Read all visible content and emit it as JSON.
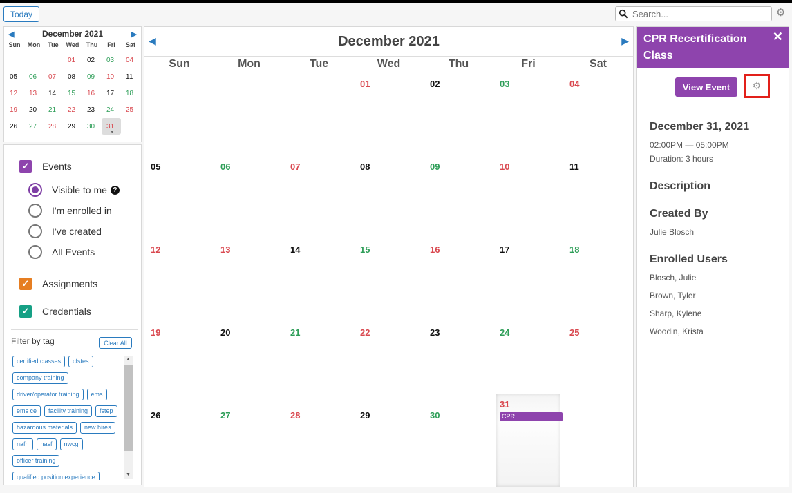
{
  "toolbar": {
    "today_label": "Today",
    "search_placeholder": "Search..."
  },
  "mini_calendar": {
    "title": "December 2021",
    "dow": [
      "Sun",
      "Mon",
      "Tue",
      "Wed",
      "Thu",
      "Fri",
      "Sat"
    ],
    "weeks": [
      [
        "",
        "",
        "",
        "01",
        "02",
        "03",
        "04"
      ],
      [
        "05",
        "06",
        "07",
        "08",
        "09",
        "10",
        "11"
      ],
      [
        "12",
        "13",
        "14",
        "15",
        "16",
        "17",
        "18"
      ],
      [
        "19",
        "20",
        "21",
        "22",
        "23",
        "24",
        "25"
      ],
      [
        "26",
        "27",
        "28",
        "29",
        "30",
        "31",
        ""
      ]
    ],
    "selected": "31"
  },
  "filters": {
    "events_label": "Events",
    "radios": [
      "Visible to me",
      "I'm enrolled in",
      "I've created",
      "All Events"
    ],
    "assignments_label": "Assignments",
    "credentials_label": "Credentials",
    "filter_by_tag_label": "Filter by tag",
    "clear_all_label": "Clear All",
    "tags": [
      "certified classes",
      "cfstes",
      "company training",
      "driver/operator training",
      "ems",
      "ems ce",
      "facility training",
      "fstep",
      "hazardous materials",
      "new hires",
      "nafri",
      "nasf",
      "nwcg",
      "officer training",
      "qualified position experience"
    ],
    "colors": {
      "events": "#8e44ad",
      "assignments": "#e67e22",
      "credentials": "#16a085"
    }
  },
  "calendar": {
    "title": "December 2021",
    "dow": [
      "Sun",
      "Mon",
      "Tue",
      "Wed",
      "Thu",
      "Fri",
      "Sat"
    ],
    "weeks": [
      [
        "",
        "",
        "",
        "01",
        "02",
        "03",
        "04"
      ],
      [
        "05",
        "06",
        "07",
        "08",
        "09",
        "10",
        "11"
      ],
      [
        "12",
        "13",
        "14",
        "15",
        "16",
        "17",
        "18"
      ],
      [
        "19",
        "20",
        "21",
        "22",
        "23",
        "24",
        "25"
      ],
      [
        "26",
        "27",
        "28",
        "29",
        "30",
        "31",
        ""
      ]
    ],
    "event": {
      "day": "31",
      "label": "CPR"
    }
  },
  "panel": {
    "title": "CPR Recertification Class",
    "view_event_label": "View Event",
    "date": "December 31, 2021",
    "time": "02:00PM — 05:00PM",
    "duration": "Duration: 3 hours",
    "description_heading": "Description",
    "created_by_heading": "Created By",
    "created_by": "Julie Blosch",
    "enrolled_heading": "Enrolled Users",
    "enrolled": [
      "Blosch, Julie",
      "Brown, Tyler",
      "Sharp, Kylene",
      "Woodin, Krista"
    ]
  }
}
